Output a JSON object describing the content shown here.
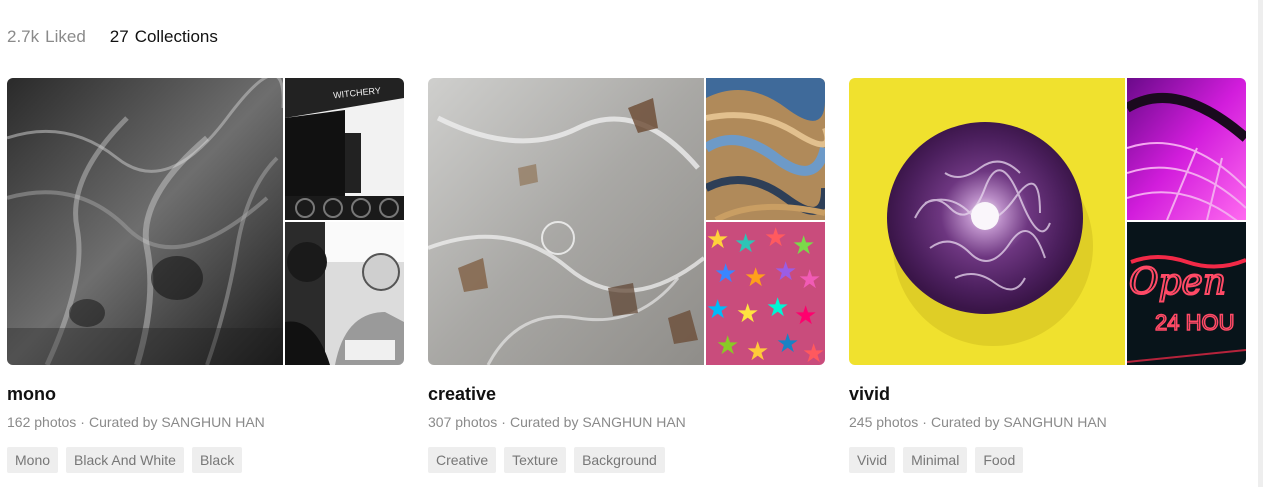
{
  "tabs": [
    {
      "count": "2.7k",
      "label": "Liked",
      "active": false
    },
    {
      "count": "27",
      "label": "Collections",
      "active": true
    }
  ],
  "collections": [
    {
      "title": "mono",
      "photos": "162 photos",
      "curated": "Curated by SANGHUN HAN",
      "tags": [
        "Mono",
        "Black And White",
        "Black"
      ],
      "images": [
        "tree-bark-bw-photo",
        "witchery-building-bw-photo",
        "boxer-bw-photo"
      ],
      "sign_text": "WITCHERY"
    },
    {
      "title": "creative",
      "photos": "307 photos",
      "curated": "Curated by SANGHUN HAN",
      "tags": [
        "Creative",
        "Texture",
        "Background"
      ],
      "images": [
        "ice-texture-photo",
        "wood-texture-photo",
        "star-confetti-photo"
      ]
    },
    {
      "title": "vivid",
      "photos": "245 photos",
      "curated": "Curated by SANGHUN HAN",
      "tags": [
        "Vivid",
        "Minimal",
        "Food"
      ],
      "images": [
        "red-cabbage-photo",
        "magenta-curves-photo",
        "neon-sign-photo"
      ],
      "neon_text": "Open",
      "neon_subtext": "24 HOU"
    }
  ],
  "colors": {
    "text_primary": "#111111",
    "text_muted": "#8a8a8a",
    "tag_bg": "#eeeeee",
    "vivid_yellow": "#f0e12e",
    "cabbage_purple": "#5e2d6e",
    "neon_red": "#ff2a4a"
  }
}
